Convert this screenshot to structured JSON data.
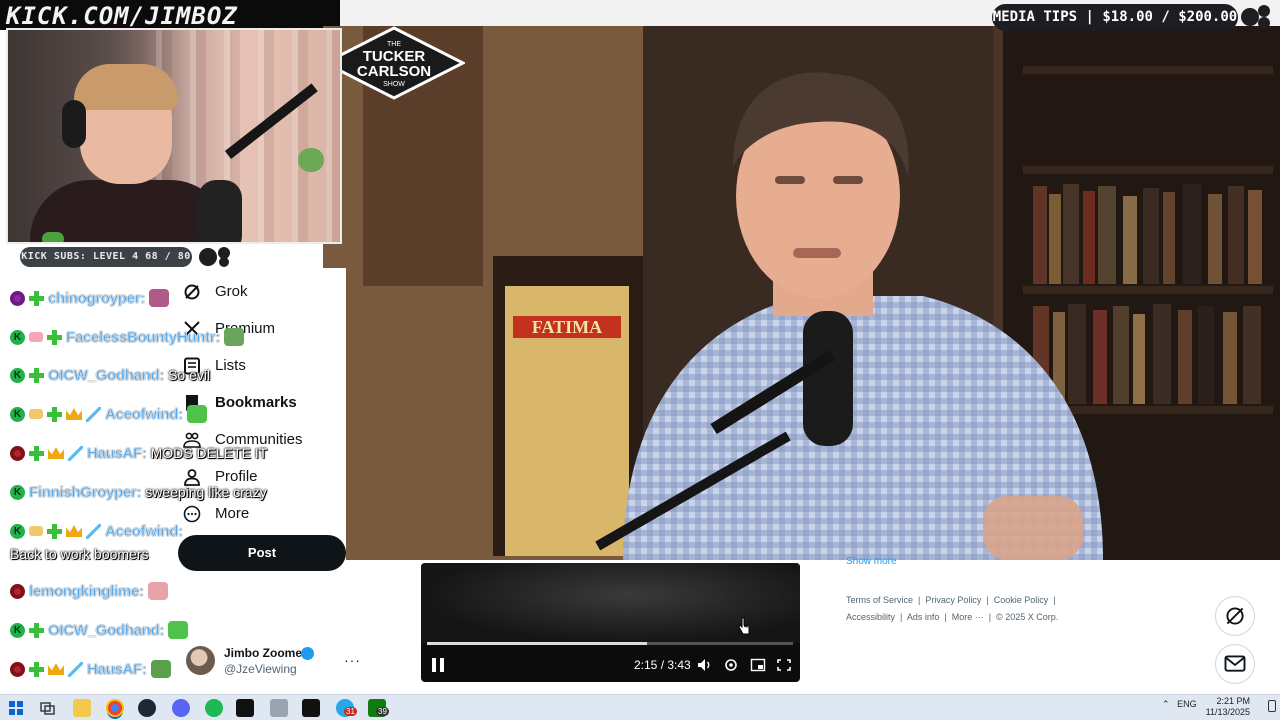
{
  "stream": {
    "channel": "KICK.COM/JIMBOZ",
    "media_tips": "MEDIA TIPS | $18.00 / $200.00",
    "subs_goal": "KICK SUBS: LEVEL 4 68 / 80"
  },
  "video": {
    "watermark_line1": "THE",
    "watermark_line2": "TUCKER",
    "watermark_line3": "CARLSON",
    "watermark_line4": "SHOW",
    "sign_text": "FATIMA"
  },
  "nav": {
    "items": [
      {
        "label": "Grok",
        "icon": "grok-icon"
      },
      {
        "label": "Premium",
        "icon": "x-logo-icon"
      },
      {
        "label": "Lists",
        "icon": "lists-icon"
      },
      {
        "label": "Bookmarks",
        "icon": "bookmark-icon",
        "active": true
      },
      {
        "label": "Communities",
        "icon": "communities-icon"
      },
      {
        "label": "Profile",
        "icon": "profile-icon"
      },
      {
        "label": "More",
        "icon": "more-icon"
      }
    ],
    "post_button": "Post"
  },
  "account": {
    "name": "Jimbo Zoomer",
    "handle": "@JzeViewing",
    "more": "···"
  },
  "chat": {
    "messages": [
      {
        "user": "chinogroyper:",
        "text": "",
        "color": "#4fa8f0",
        "badges": [
          "purple-ring",
          "plus"
        ]
      },
      {
        "user": "FacelessBountyHuntr:",
        "text": "",
        "color": "#4fa8f0",
        "badges": [
          "kick",
          "pink",
          "plus"
        ]
      },
      {
        "user": "OICW_Godhand:",
        "text": "So evil",
        "color": "#4fa8f0",
        "badges": [
          "kick",
          "plus"
        ]
      },
      {
        "user": "Aceofwind:",
        "text": "",
        "color": "#4fa8f0",
        "badges": [
          "kick",
          "sand",
          "plus",
          "crown",
          "sword"
        ]
      },
      {
        "user": "HausAF:",
        "text": "MODS DELETE IT",
        "color": "#4fa8f0",
        "badges": [
          "red-ring",
          "plus",
          "crown",
          "sword"
        ]
      },
      {
        "user": "FinnishGroyper:",
        "text": "sweeping like crazy",
        "color": "#4fa8f0",
        "badges": [
          "kick"
        ]
      },
      {
        "user": "Aceofwind:",
        "text": "",
        "color": "#4fa8f0",
        "badges": [
          "kick",
          "sand",
          "plus",
          "crown",
          "sword"
        ]
      },
      {
        "user": "",
        "text": "Back to work boomers",
        "color": "#4fa8f0",
        "badges": []
      },
      {
        "user": "lemongkinglime:",
        "text": "",
        "color": "#4fa8f0",
        "badges": [
          "red-ring"
        ]
      },
      {
        "user": "OICW_Godhand:",
        "text": "",
        "color": "#4fa8f0",
        "badges": [
          "kick",
          "plus"
        ]
      },
      {
        "user": "HausAF:",
        "text": "",
        "color": "#4fa8f0",
        "badges": [
          "red-ring",
          "plus",
          "crown",
          "sword"
        ]
      }
    ]
  },
  "player": {
    "time": "2:15 / 3:43",
    "progress": 0.6
  },
  "footer": {
    "show_more": "Show more",
    "line1": [
      "Terms of Service",
      "Privacy Policy",
      "Cookie Policy"
    ],
    "line2": [
      "Accessibility",
      "Ads info",
      "More ···",
      "© 2025 X Corp."
    ]
  },
  "taskbar": {
    "lang": "ENG",
    "time": "2:21 PM",
    "date": "11/13/2025",
    "badge1": "31",
    "badge2": "39"
  },
  "colors": {
    "accent": "#1d9bf0",
    "kick_green": "#53fc18",
    "x_black": "#0f1419"
  }
}
